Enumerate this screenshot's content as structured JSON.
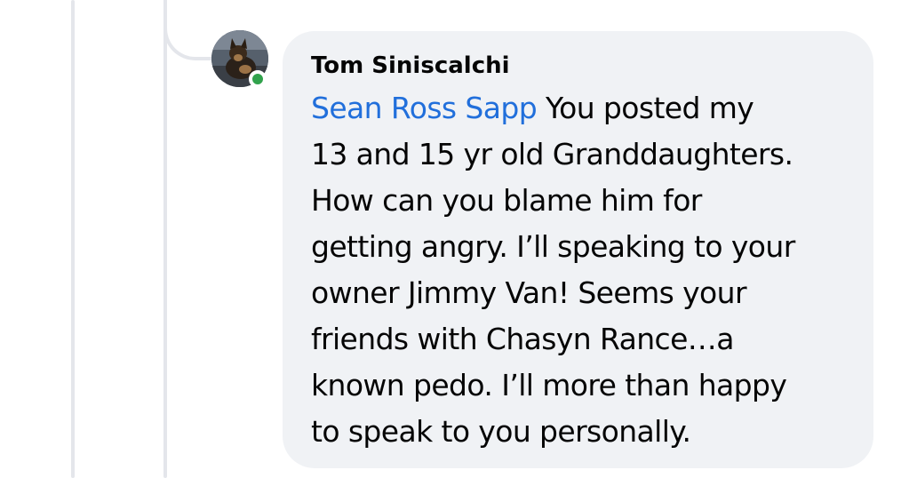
{
  "comment": {
    "author": "Tom Siniscalchi",
    "mention": "Sean Ross Sapp",
    "lines": [
      " You posted my",
      "13 and 15 yr old Granddaughters.",
      "How can you blame him for",
      "getting angry. I’ll speaking to your",
      "owner Jimmy Van! Seems your",
      "friends with Chasyn Rance…a",
      "known pedo. I’ll more than happy",
      "to speak to you personally."
    ]
  },
  "presence": {
    "status_color": "#31a24c"
  },
  "colors": {
    "bubble": "#f0f2f5",
    "mention": "#216fdb",
    "thread_line": "#e4e6eb"
  }
}
